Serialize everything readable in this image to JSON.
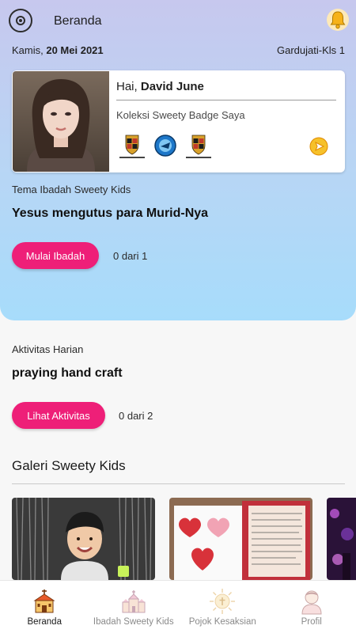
{
  "header": {
    "title": "Beranda",
    "menu_icon": "circle-menu-icon",
    "notification_icon": "bell-icon"
  },
  "info": {
    "day": "Kamis,",
    "date": "20 Mei 2021",
    "school": "Gardujati-Kls 1"
  },
  "profile_card": {
    "greeting_prefix": "Hai,",
    "name": "David June",
    "badge_collection_label": "Koleksi Sweety Badge Saya",
    "badges": [
      "porsche-badge-icon",
      "blue-emblem-badge-icon",
      "porsche-badge-icon"
    ],
    "next_icon": "arrow-right-icon"
  },
  "worship": {
    "label": "Tema Ibadah Sweety Kids",
    "title": "Yesus mengutus para Murid-Nya",
    "button": "Mulai Ibadah",
    "progress": "0 dari 1"
  },
  "activity": {
    "label": "Aktivitas Harian",
    "title": "praying hand craft",
    "button": "Lihat Aktivitas",
    "progress": "0 dari 2"
  },
  "gallery": {
    "title": "Galeri Sweety Kids"
  },
  "nav": {
    "items": [
      {
        "label": "Beranda",
        "icon": "church-icon",
        "active": true
      },
      {
        "label": "Ibadah Sweety Kids",
        "icon": "cathedral-icon",
        "active": false
      },
      {
        "label": "Pojok Kesaksian",
        "icon": "sun-cross-icon",
        "active": false
      },
      {
        "label": "Profil",
        "icon": "person-icon",
        "active": false
      }
    ]
  },
  "colors": {
    "accent": "#ee1f78",
    "hero_top": "#c7c8ee",
    "hero_bottom": "#a7dcfb",
    "bell": "#f6b21a"
  }
}
